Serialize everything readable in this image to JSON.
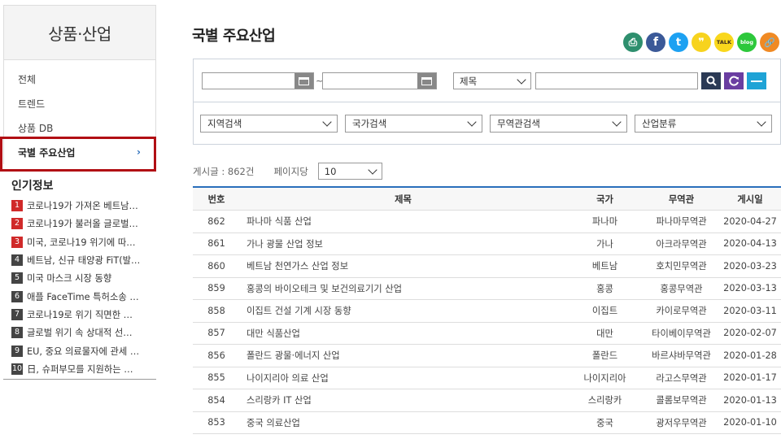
{
  "sidebar": {
    "title": "상품·산업",
    "items": [
      {
        "label": "전체"
      },
      {
        "label": "트렌드"
      },
      {
        "label": "상품 DB"
      },
      {
        "label": "국별 주요산업",
        "chevron": "›"
      }
    ]
  },
  "popular": {
    "title": "인기정보",
    "items": [
      {
        "num": "1",
        "text": "코로나19가 가져온 베트남…"
      },
      {
        "num": "2",
        "text": "코로나19가 불러올 글로벌…"
      },
      {
        "num": "3",
        "text": "미국, 코로나19 위기에 따…"
      },
      {
        "num": "4",
        "text": "베트남, 신규 태양광 FiT(발…"
      },
      {
        "num": "5",
        "text": "미국 마스크 시장 동향"
      },
      {
        "num": "6",
        "text": "애플 FaceTime 특허소송 …"
      },
      {
        "num": "7",
        "text": "코로나19로 위기 직면한 …"
      },
      {
        "num": "8",
        "text": "글로벌 위기 속 상대적 선…"
      },
      {
        "num": "9",
        "text": "EU, 중요 의료물자에 관세 …"
      },
      {
        "num": "10",
        "text": "日, 슈퍼부모를 지원하는 …"
      }
    ],
    "colors": {
      "top3": "#d02a2a",
      "rest": "#444444"
    }
  },
  "page": {
    "title": "국별 주요산업"
  },
  "share_icons": [
    {
      "icon": "print-icon",
      "glyph": "⎙",
      "color": "#2e8f6e"
    },
    {
      "icon": "facebook-icon",
      "glyph": "f",
      "color": "#3b5998"
    },
    {
      "icon": "twitter-icon",
      "glyph": "t",
      "color": "#1da1f2"
    },
    {
      "icon": "kakaostory-icon",
      "glyph": "❞",
      "color": "#f7d31e"
    },
    {
      "icon": "kakaotalk-icon",
      "glyph": "TALK",
      "color": "#f9d71c"
    },
    {
      "icon": "blog-icon",
      "glyph": "blog",
      "color": "#2dc83b"
    },
    {
      "icon": "link-icon",
      "glyph": "🔗",
      "color": "#f08a24"
    }
  ],
  "search": {
    "date_from": "",
    "date_to": "",
    "tilde": "~",
    "field_select": "제목",
    "keyword": "",
    "filters": [
      "지역검색",
      "국가검색",
      "무역관검색",
      "산업분류"
    ],
    "button_colors": {
      "search": "#2b3a55",
      "reset": "#6a3ea1",
      "collapse": "#1fa3d6"
    }
  },
  "meta": {
    "count_label": "게시글 : 862건",
    "per_page_label": "페이지당",
    "per_page_value": "10"
  },
  "table": {
    "headers": {
      "no": "번호",
      "title": "제목",
      "country": "국가",
      "office": "무역관",
      "date": "게시일"
    },
    "rows": [
      {
        "no": "862",
        "title": "파나마 식품 산업",
        "country": "파나마",
        "office": "파나마무역관",
        "date": "2020-04-27"
      },
      {
        "no": "861",
        "title": "가나 광물 산업 정보",
        "country": "가나",
        "office": "아크라무역관",
        "date": "2020-04-13"
      },
      {
        "no": "860",
        "title": "베트남 천연가스 산업 정보",
        "country": "베트남",
        "office": "호치민무역관",
        "date": "2020-03-23"
      },
      {
        "no": "859",
        "title": "홍콩의 바이오테크 및 보건의료기기 산업",
        "country": "홍콩",
        "office": "홍콩무역관",
        "date": "2020-03-13"
      },
      {
        "no": "858",
        "title": "이집트 건설 기계 시장 동향",
        "country": "이집트",
        "office": "카이로무역관",
        "date": "2020-03-11"
      },
      {
        "no": "857",
        "title": "대만 식품산업",
        "country": "대만",
        "office": "타이베이무역관",
        "date": "2020-02-07"
      },
      {
        "no": "856",
        "title": "폴란드 광물·에너지 산업",
        "country": "폴란드",
        "office": "바르샤바무역관",
        "date": "2020-01-28"
      },
      {
        "no": "855",
        "title": "나이지리아 의료 산업",
        "country": "나이지리아",
        "office": "라고스무역관",
        "date": "2020-01-17"
      },
      {
        "no": "854",
        "title": "스리랑카 IT 산업",
        "country": "스리랑카",
        "office": "콜롬보무역관",
        "date": "2020-01-13"
      },
      {
        "no": "853",
        "title": "중국 의료산업",
        "country": "중국",
        "office": "광저우무역관",
        "date": "2020-01-10"
      }
    ]
  }
}
